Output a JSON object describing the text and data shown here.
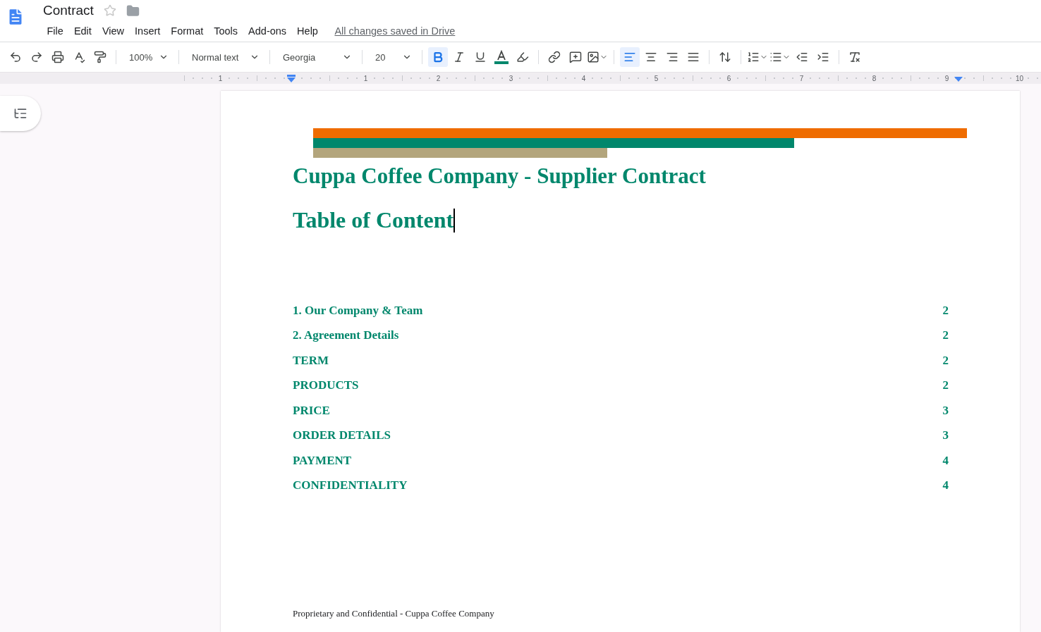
{
  "document": {
    "title": "Contract",
    "starred": false
  },
  "menu": [
    "File",
    "Edit",
    "View",
    "Insert",
    "Format",
    "Tools",
    "Add-ons",
    "Help"
  ],
  "save_status": "All changes saved in Drive",
  "toolbar": {
    "zoom": "100%",
    "style": "Normal text",
    "font": "Georgia",
    "size": "20"
  },
  "format": [
    {
      "kind": "bold",
      "selected": true
    },
    {
      "kind": "italic",
      "selected": false
    },
    {
      "kind": "underline",
      "selected": false
    }
  ],
  "alignments": [
    {
      "kind": "left",
      "selected": true
    },
    {
      "kind": "center",
      "selected": false
    },
    {
      "kind": "right",
      "selected": false
    },
    {
      "kind": "justify",
      "selected": false
    }
  ],
  "ruler_labels": [
    "1",
    "1",
    "2",
    "3",
    "4",
    "5",
    "6",
    "7",
    "8",
    "9",
    "10"
  ],
  "banner_bars": [
    {
      "color": "#ef6c00"
    },
    {
      "color": "#00876c"
    },
    {
      "color": "#b3a57c"
    }
  ],
  "heading": "Cuppa Coffee Company - Supplier Contract",
  "toc_heading": "Table of Content",
  "toc": [
    {
      "title": "1. Our Company & Team",
      "page": "2"
    },
    {
      "title": "2. Agreement Details",
      "page": "2"
    },
    {
      "title": "TERM",
      "page": "2"
    },
    {
      "title": "PRODUCTS",
      "page": "2"
    },
    {
      "title": "PRICE",
      "page": "3"
    },
    {
      "title": "ORDER DETAILS",
      "page": "3"
    },
    {
      "title": "PAYMENT",
      "page": "4"
    },
    {
      "title": "CONFIDENTIALITY",
      "page": "4"
    }
  ],
  "footer": "Proprietary and Confidential - Cuppa Coffee Company"
}
